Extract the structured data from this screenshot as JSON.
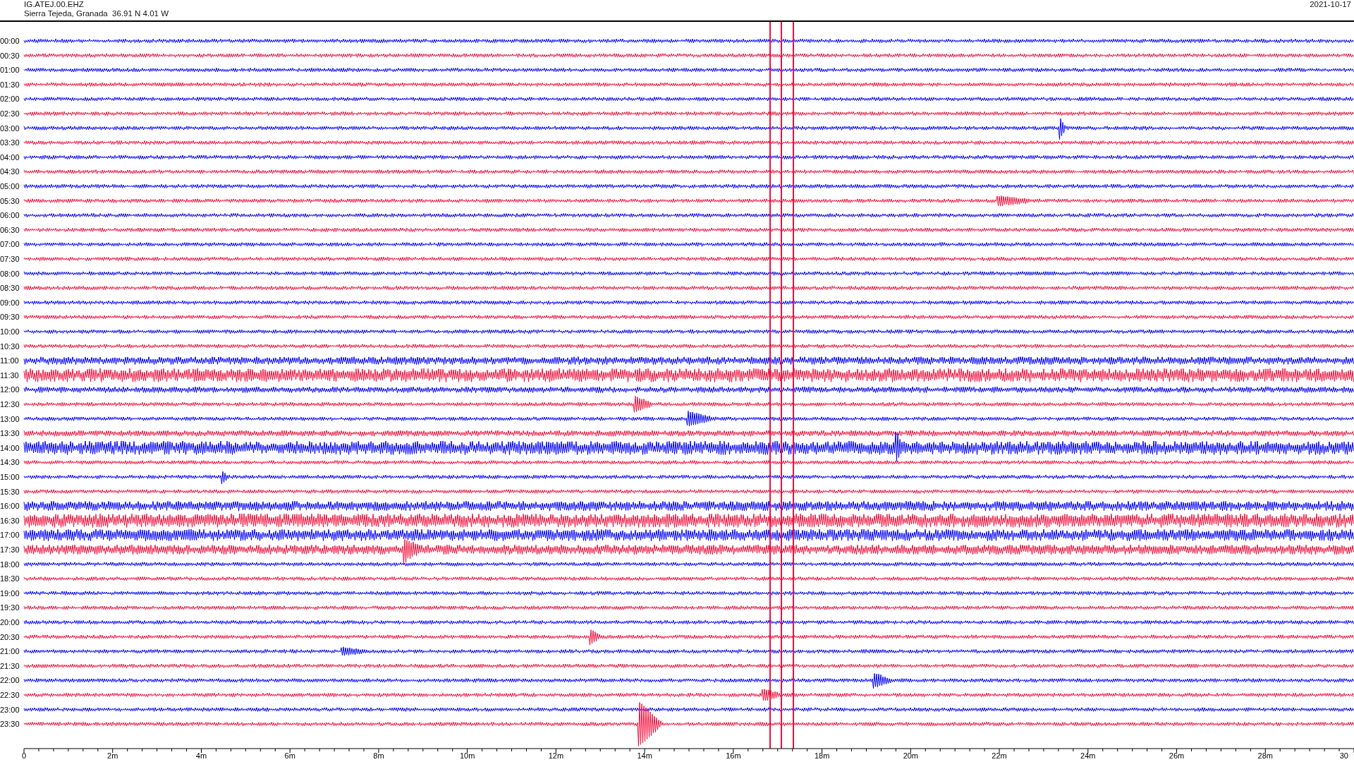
{
  "header": {
    "station": "IG.ATEJ.00.EHZ",
    "location": "Sierra Tejeda, Granada  36.91 N 4.01 W",
    "date": "2021-10-17"
  },
  "traces": [
    {
      "time": "00:00",
      "color": "#0000ff"
    },
    {
      "time": "00:30",
      "color": "#f0103c"
    },
    {
      "time": "01:00",
      "color": "#0000ff"
    },
    {
      "time": "01:30",
      "color": "#f0103c"
    },
    {
      "time": "02:00",
      "color": "#0000ff"
    },
    {
      "time": "02:30",
      "color": "#f0103c"
    },
    {
      "time": "03:00",
      "color": "#0000ff"
    },
    {
      "time": "03:30",
      "color": "#f0103c"
    },
    {
      "time": "04:00",
      "color": "#0000ff"
    },
    {
      "time": "04:30",
      "color": "#f0103c"
    },
    {
      "time": "05:00",
      "color": "#0000ff"
    },
    {
      "time": "05:30",
      "color": "#f0103c"
    },
    {
      "time": "06:00",
      "color": "#0000ff"
    },
    {
      "time": "06:30",
      "color": "#f0103c"
    },
    {
      "time": "07:00",
      "color": "#0000ff"
    },
    {
      "time": "07:30",
      "color": "#f0103c"
    },
    {
      "time": "08:00",
      "color": "#0000ff"
    },
    {
      "time": "08:30",
      "color": "#f0103c"
    },
    {
      "time": "09:00",
      "color": "#0000ff"
    },
    {
      "time": "09:30",
      "color": "#f0103c"
    },
    {
      "time": "10:00",
      "color": "#0000ff"
    },
    {
      "time": "10:30",
      "color": "#f0103c"
    },
    {
      "time": "11:00",
      "color": "#0000ff"
    },
    {
      "time": "11:30",
      "color": "#f0103c"
    },
    {
      "time": "12:00",
      "color": "#0000ff"
    },
    {
      "time": "12:30",
      "color": "#f0103c"
    },
    {
      "time": "13:00",
      "color": "#0000ff"
    },
    {
      "time": "13:30",
      "color": "#f0103c"
    },
    {
      "time": "14:00",
      "color": "#0000ff"
    },
    {
      "time": "14:30",
      "color": "#f0103c"
    },
    {
      "time": "15:00",
      "color": "#0000ff"
    },
    {
      "time": "15:30",
      "color": "#f0103c"
    },
    {
      "time": "16:00",
      "color": "#0000ff"
    },
    {
      "time": "16:30",
      "color": "#f0103c"
    },
    {
      "time": "17:00",
      "color": "#0000ff"
    },
    {
      "time": "17:30",
      "color": "#f0103c"
    },
    {
      "time": "18:00",
      "color": "#0000ff"
    },
    {
      "time": "18:30",
      "color": "#f0103c"
    },
    {
      "time": "19:00",
      "color": "#0000ff"
    },
    {
      "time": "19:30",
      "color": "#f0103c"
    },
    {
      "time": "20:00",
      "color": "#0000ff"
    },
    {
      "time": "20:30",
      "color": "#f0103c"
    },
    {
      "time": "21:00",
      "color": "#0000ff"
    },
    {
      "time": "21:30",
      "color": "#f0103c"
    },
    {
      "time": "22:00",
      "color": "#0000ff"
    },
    {
      "time": "22:30",
      "color": "#f0103c"
    },
    {
      "time": "23:00",
      "color": "#0000ff"
    },
    {
      "time": "23:30",
      "color": "#f0103c"
    }
  ],
  "x_axis": {
    "ticks": [
      "0",
      "2m",
      "4m",
      "6m",
      "8m",
      "10m",
      "12m",
      "14m",
      "16m",
      "18m",
      "20m",
      "22m",
      "24m",
      "26m",
      "28m",
      "30"
    ]
  }
}
